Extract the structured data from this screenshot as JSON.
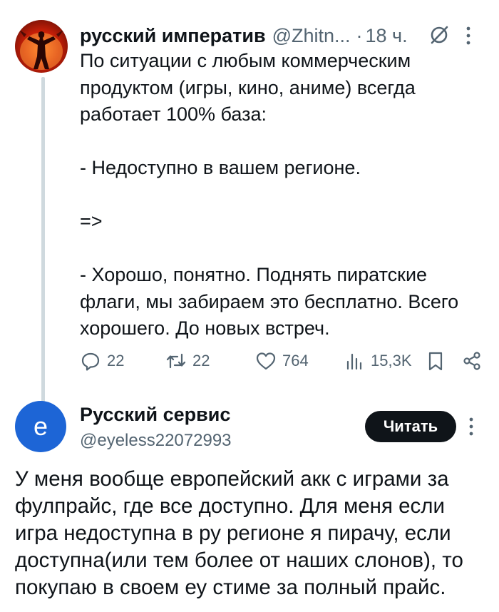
{
  "tweet1": {
    "author_name": "русский императив",
    "handle": "@Zhitn...",
    "separator": "·",
    "time": "18 ч.",
    "text": "По ситуации с любым коммерческим продуктом (игры, кино, аниме) всегда работает 100% база:\n\n- Недоступно в вашем регионе.\n\n=>\n\n- Хорошо, понятно. Поднять пиратские флаги, мы забираем это бесплатно. Всего хорошего. До новых встреч.",
    "stats": {
      "replies": "22",
      "retweets": "22",
      "likes": "764",
      "views": "15,3K"
    },
    "icons": [
      "grok-icon",
      "more-icon",
      "reply-icon",
      "retweet-icon",
      "like-icon",
      "views-icon",
      "bookmark-icon",
      "share-icon"
    ]
  },
  "tweet2": {
    "avatar_letter": "e",
    "author_name": "Русский сервис",
    "handle": "@eyeless22072993",
    "follow_label": "Читать",
    "text": "У меня вообще европейский акк с играми за фулпрайс, где все доступно. Для меня если игра недоступна в ру регионе я пирачу, если доступна(или тем более от наших слонов), то покупаю в своем еу стиме за полный прайс."
  },
  "colors": {
    "text": "#0f1419",
    "secondary": "#536471",
    "thread_line": "#cfd9de",
    "avatar2_bg": "#1d65d6",
    "button_bg": "#0f1419"
  }
}
